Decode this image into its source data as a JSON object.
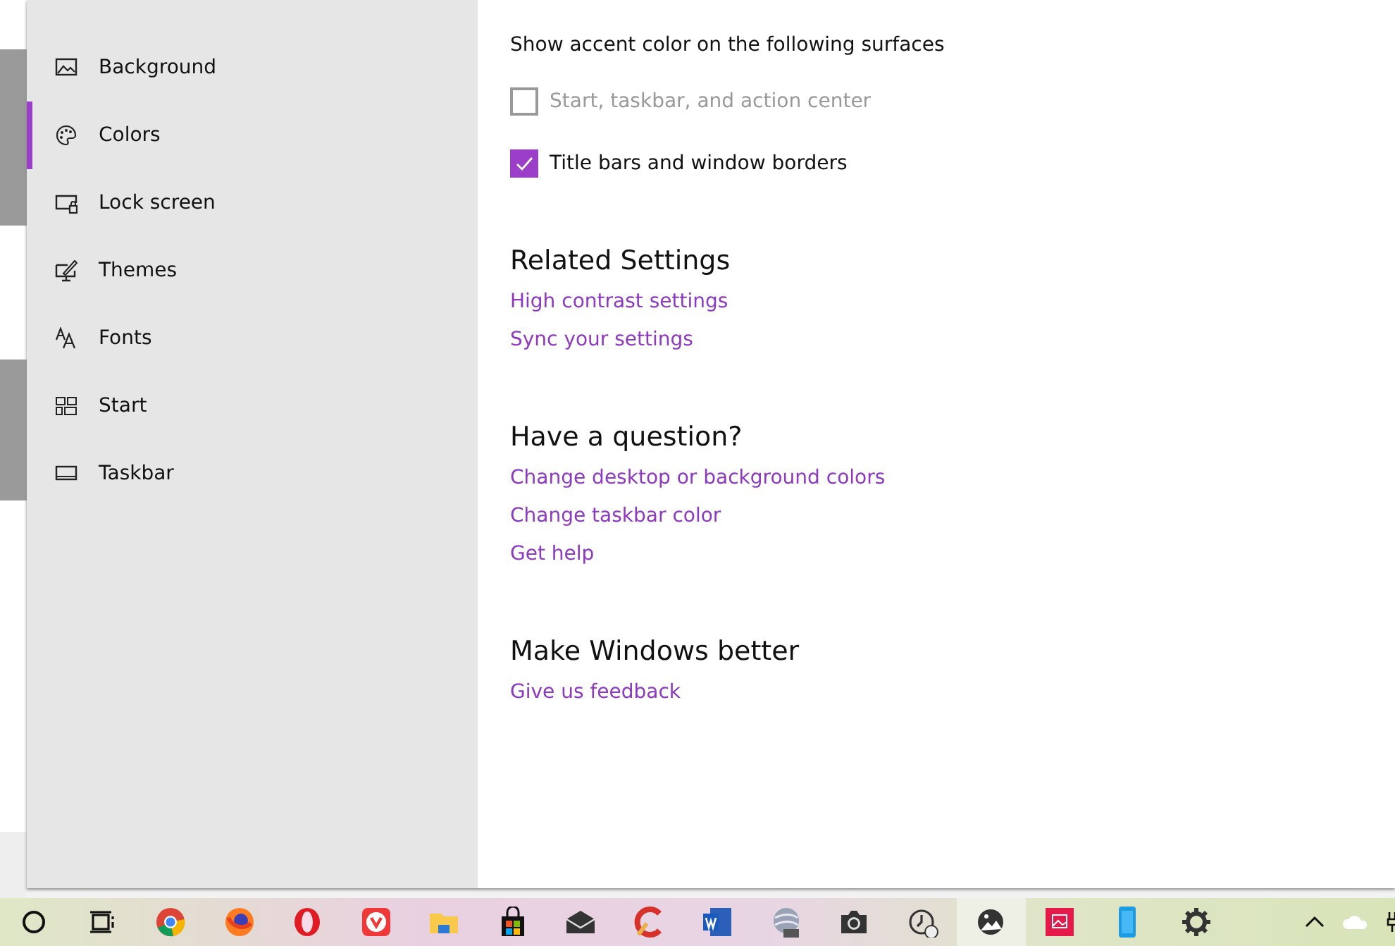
{
  "sidebar": {
    "items": [
      {
        "label": "Background",
        "kind": "picture",
        "selected": false
      },
      {
        "label": "Colors",
        "kind": "palette",
        "selected": true
      },
      {
        "label": "Lock screen",
        "kind": "lock",
        "selected": false
      },
      {
        "label": "Themes",
        "kind": "themes",
        "selected": false
      },
      {
        "label": "Fonts",
        "kind": "fonts",
        "selected": false
      },
      {
        "label": "Start",
        "kind": "start",
        "selected": false
      },
      {
        "label": "Taskbar",
        "kind": "taskbar",
        "selected": false
      }
    ]
  },
  "accent": {
    "heading": "Show accent color on the following surfaces",
    "options": [
      {
        "label": "Start, taskbar, and action center",
        "checked": false,
        "disabled": true
      },
      {
        "label": "Title bars and window borders",
        "checked": true,
        "disabled": false
      }
    ]
  },
  "sections": [
    {
      "title": "Related Settings",
      "links": [
        "High contrast settings",
        "Sync your settings"
      ]
    },
    {
      "title": "Have a question?",
      "links": [
        "Change desktop or background colors",
        "Change taskbar color",
        "Get help"
      ]
    },
    {
      "title": "Make Windows better",
      "links": [
        "Give us feedback"
      ]
    }
  ],
  "taskbar": {
    "items": [
      {
        "kind": "search",
        "selected": false
      },
      {
        "kind": "taskview",
        "selected": false
      },
      {
        "kind": "chrome",
        "selected": false
      },
      {
        "kind": "firefox",
        "selected": false
      },
      {
        "kind": "opera",
        "selected": false
      },
      {
        "kind": "vivaldi",
        "selected": false
      },
      {
        "kind": "folder",
        "selected": false
      },
      {
        "kind": "store",
        "selected": false
      },
      {
        "kind": "mail",
        "selected": false
      },
      {
        "kind": "ccleaner",
        "selected": false
      },
      {
        "kind": "word",
        "selected": false
      },
      {
        "kind": "globe",
        "selected": false
      },
      {
        "kind": "camera",
        "selected": false
      },
      {
        "kind": "alarm",
        "selected": false
      },
      {
        "kind": "photos",
        "selected": true
      },
      {
        "kind": "picture",
        "selected": false
      },
      {
        "kind": "phone",
        "selected": false
      },
      {
        "kind": "settings",
        "selected": false
      }
    ]
  }
}
